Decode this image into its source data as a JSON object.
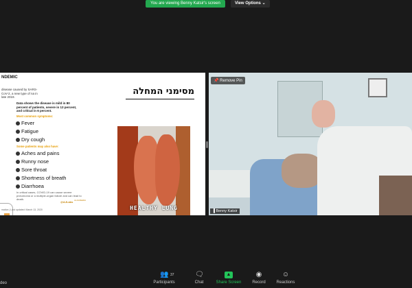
{
  "top": {
    "banner": "You are viewing Benny Katsir's screen",
    "view_options": "View Options ⌄"
  },
  "slide": {
    "title_fragment": "NDEMIC",
    "heading_he": "מסימני המחלה",
    "intro": "disease caused by SARS-CoV-2, a new type of na in late 2019.",
    "data_line": "Data shows the disease is mild in 80 percent of patients, severe in 13 percent, and critical in 6 percent.",
    "most_common_label": "Most common symptoms:",
    "most_common": [
      "Fever",
      "Fatigue",
      "Dry cough"
    ],
    "some_patients_label": "Some patients may also have:",
    "some_patients": [
      "Aches and pains",
      "Runny nose",
      "Sore throat",
      "Shortness of breath",
      "Diarrhoea"
    ],
    "footnote": "In critical cases, COVID-19 can cause severe pneumonia or a multiple-organ failure and can lead to death.",
    "updated": "mation | Last updated: March 13, 2020",
    "handle": "@AJLabs",
    "logo_text": "ALJAZEERA",
    "image_caption": "HEALTHY LUNG"
  },
  "video": {
    "remove_pin": "Remove Pin",
    "participant_name": "Benny Katsir"
  },
  "toolbar": {
    "edge_label": "deo",
    "participants_label": "Participants",
    "participants_count": "37",
    "chat_label": "Chat",
    "share_label": "Share Screen",
    "record_label": "Record",
    "reactions_label": "Reactions"
  },
  "colors": {
    "share_green": "#23c45a",
    "banner_green": "#23a84f",
    "accent_orange": "#e69c00"
  }
}
